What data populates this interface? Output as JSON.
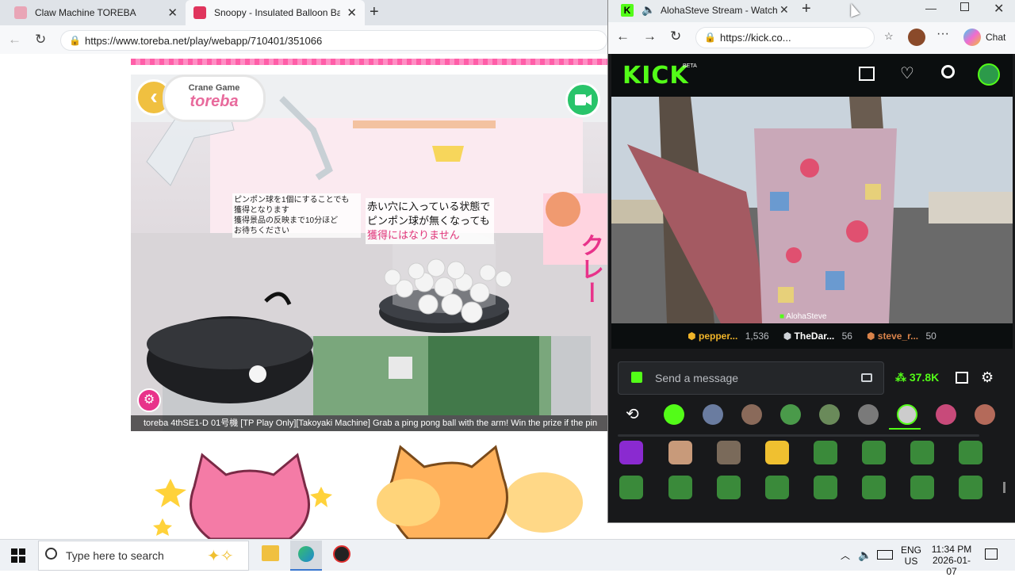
{
  "back_browser": {
    "tabs": [
      {
        "title": "Claw Machine TOREBA",
        "color": "#e9a5b6"
      },
      {
        "title": "Snoopy - Insulated Balloon Bag S",
        "color": "#e0355d"
      }
    ],
    "url": "https://www.toreba.net/play/webapp/710401/351066",
    "new_tab": "+"
  },
  "cam": {
    "logo_line1": "Crane Game",
    "logo_line2": "toreba",
    "sign_left": [
      "ピンポン球を1個にすることでも",
      "獲得となります",
      "獲得景品の反映まで10分ほど",
      "お待ちください"
    ],
    "sign_right": [
      "赤い穴に入っている状態で",
      "ピンポン球が無くなっても",
      "獲得にはなりません"
    ],
    "sign_side": "クレー",
    "caption": "toreba 4thSE1-D 01号機 [TP Play Only][Takoyaki Machine] Grab a ping pong ball with the arm! Win the prize if the pin"
  },
  "kick": {
    "tab_title": "AlohaSteve Stream - Watch L",
    "url": "https://kick.co...",
    "logo": "KICK",
    "beta": "BETA",
    "streamer_tag": "AlohaSteve",
    "leaderboard": [
      {
        "name": "pepper...",
        "count": "1,536",
        "color": "#f0b429"
      },
      {
        "name": "TheDar...",
        "count": "56",
        "color": "#cfd3d8"
      },
      {
        "name": "steve_r...",
        "count": "50",
        "color": "#d9834a"
      }
    ],
    "chat_placeholder": "Send a message",
    "points": "37.8K",
    "chat_label": "Chat",
    "accent": "#53fc18"
  },
  "taskbar": {
    "search_placeholder": "Type here to search",
    "lang1": "ENG",
    "lang2": "US",
    "time": "11:34 PM",
    "date": "2026-01-07"
  }
}
